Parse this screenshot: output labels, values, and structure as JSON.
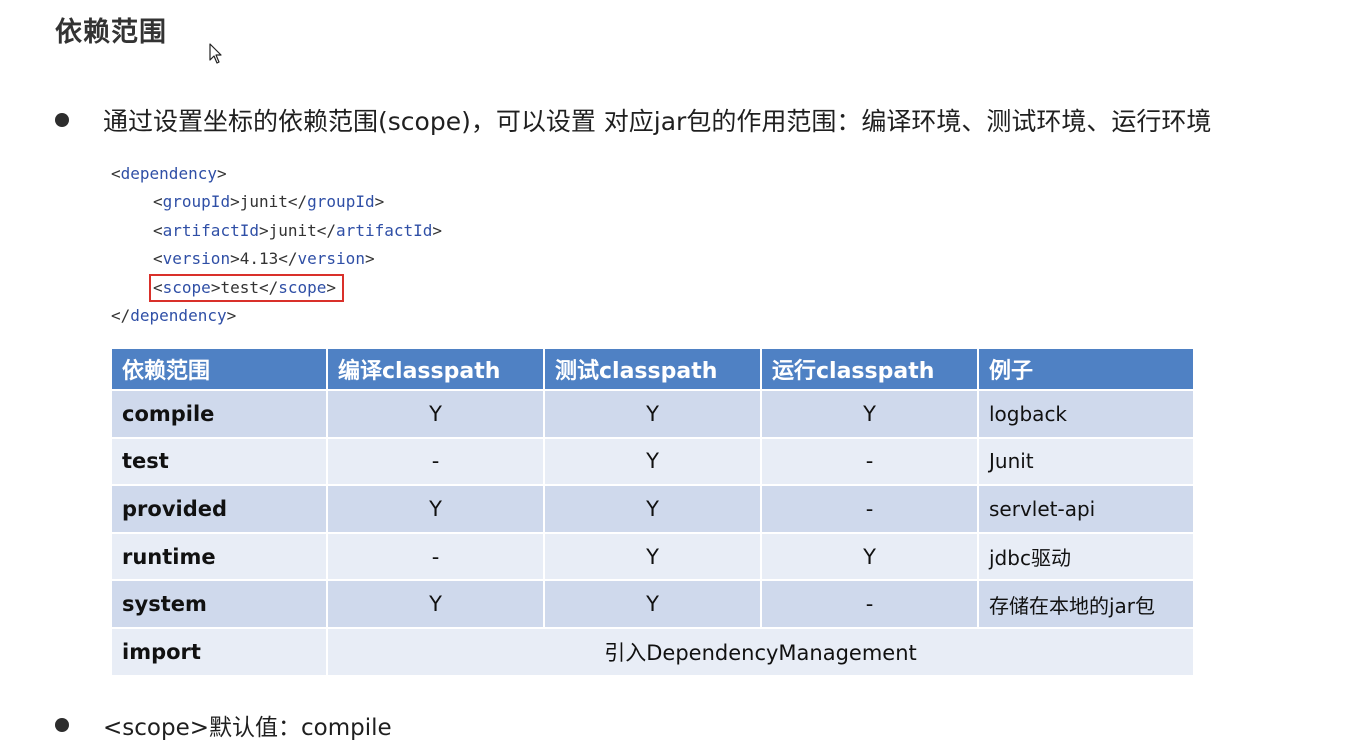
{
  "title": "依赖范围",
  "bullets": {
    "intro": "通过设置坐标的依赖范围(scope)，可以设置 对应jar包的作用范围：编译环境、测试环境、运行环境",
    "default": "<scope>默认值：compile"
  },
  "code": {
    "dependency_tag": "dependency",
    "groupId_tag": "groupId",
    "groupId_value": "junit",
    "artifactId_tag": "artifactId",
    "artifactId_value": "junit",
    "version_tag": "version",
    "version_value": "4.13",
    "scope_tag": "scope",
    "scope_value": "test",
    "highlight_color": "#d9302a"
  },
  "table": {
    "headers": [
      "依赖范围",
      "编译classpath",
      "测试classpath",
      "运行classpath",
      "例子"
    ],
    "rows": [
      {
        "scope": "compile",
        "compile": "Y",
        "test": "Y",
        "runtime": "Y",
        "example": "logback"
      },
      {
        "scope": "test",
        "compile": "-",
        "test": "Y",
        "runtime": "-",
        "example": "Junit"
      },
      {
        "scope": "provided",
        "compile": "Y",
        "test": "Y",
        "runtime": "-",
        "example": "servlet-api"
      },
      {
        "scope": "runtime",
        "compile": "-",
        "test": "Y",
        "runtime": "Y",
        "example": "jdbc驱动"
      },
      {
        "scope": "system",
        "compile": "Y",
        "test": "Y",
        "runtime": "-",
        "example": "存储在本地的jar包"
      }
    ],
    "import_row": {
      "scope": "import",
      "note": "引入DependencyManagement"
    },
    "header_color": "#4f81c4",
    "row_color_a": "#cfd9ec",
    "row_color_b": "#e8edf6"
  }
}
